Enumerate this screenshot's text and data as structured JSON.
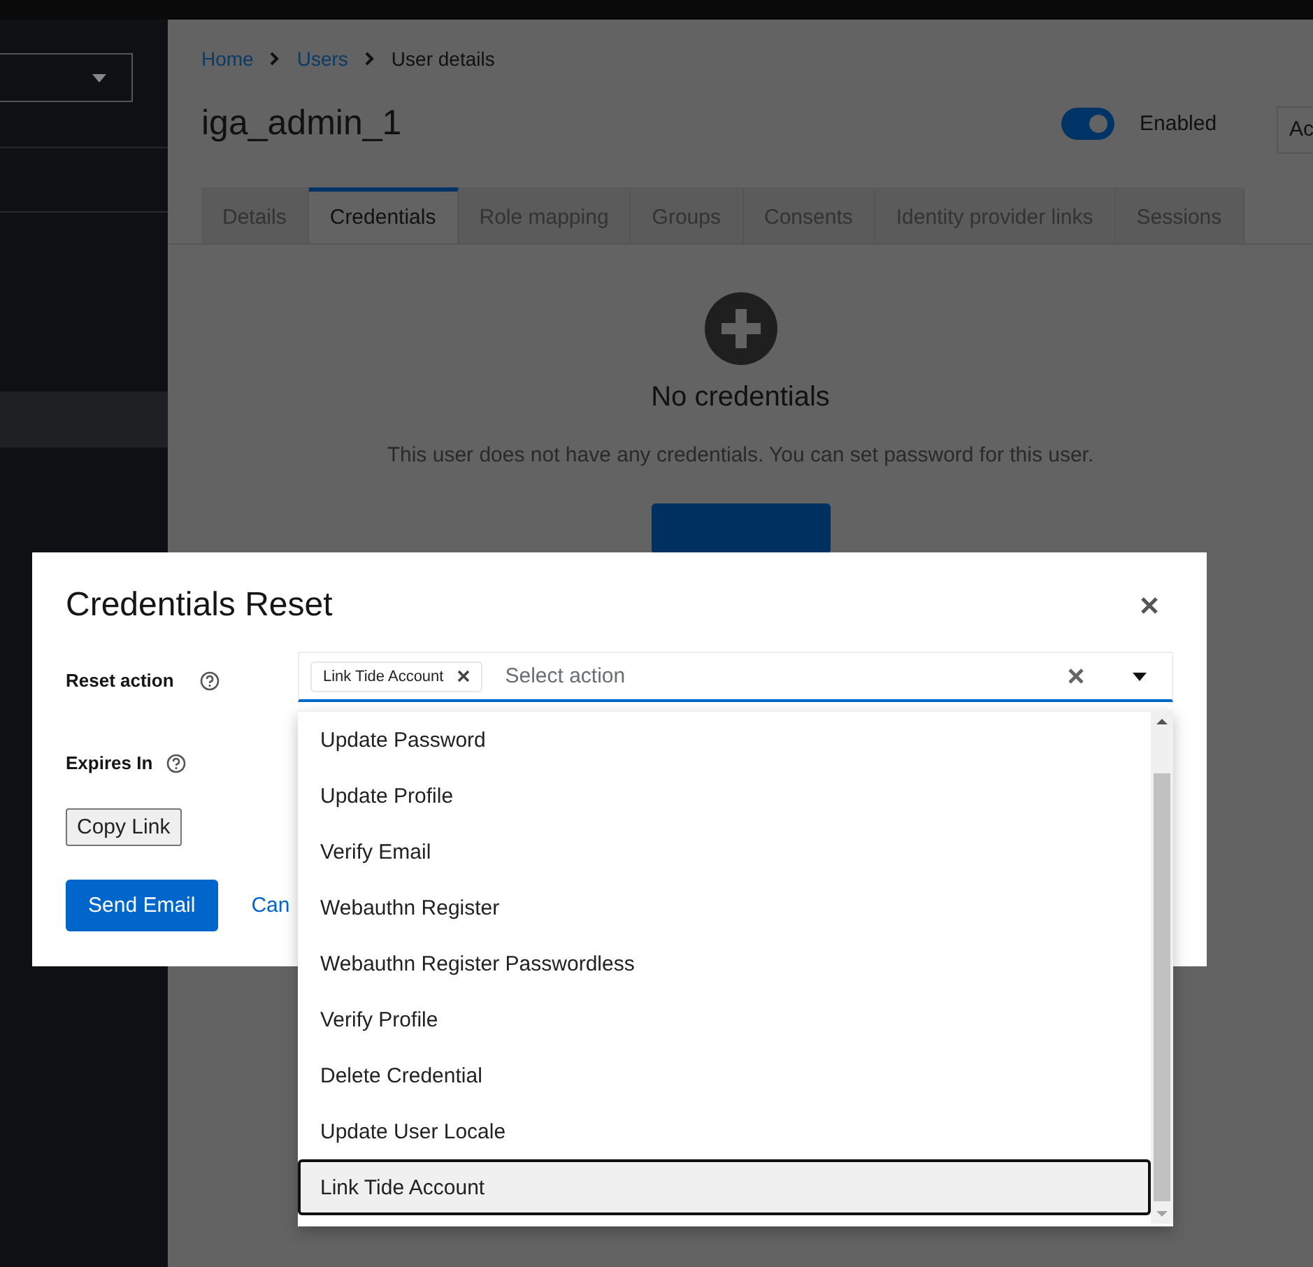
{
  "breadcrumb": [
    {
      "label": "Home",
      "link": true
    },
    {
      "label": "Users",
      "link": true
    },
    {
      "label": "User details",
      "link": false
    }
  ],
  "page_title": "iga_admin_1",
  "enabled_switch": {
    "label": "Enabled",
    "on": true
  },
  "action_button": "Ac",
  "tabs": [
    {
      "label": "Details",
      "selected": false
    },
    {
      "label": "Credentials",
      "selected": true
    },
    {
      "label": "Role mapping",
      "selected": false
    },
    {
      "label": "Groups",
      "selected": false
    },
    {
      "label": "Consents",
      "selected": false
    },
    {
      "label": "Identity provider links",
      "selected": false
    },
    {
      "label": "Sessions",
      "selected": false
    }
  ],
  "empty_state": {
    "title": "No credentials",
    "description": "This user does not have any credentials. You can set password for this user."
  },
  "modal": {
    "title": "Credentials Reset",
    "reset_action": {
      "label": "Reset action",
      "chips": [
        "Link Tide Account"
      ],
      "placeholder": "Select action"
    },
    "expires_label": "Expires In",
    "copy_button": "Copy Link",
    "send_button": "Send Email",
    "cancel_link": "Can"
  },
  "menu_items": [
    {
      "label": "Update Password",
      "selected": false
    },
    {
      "label": "Update Profile",
      "selected": false
    },
    {
      "label": "Verify Email",
      "selected": false
    },
    {
      "label": "Webauthn Register",
      "selected": false
    },
    {
      "label": "Webauthn Register Passwordless",
      "selected": false
    },
    {
      "label": "Verify Profile",
      "selected": false
    },
    {
      "label": "Delete Credential",
      "selected": false
    },
    {
      "label": "Update User Locale",
      "selected": false
    },
    {
      "label": "Link Tide Account",
      "selected": true
    }
  ]
}
